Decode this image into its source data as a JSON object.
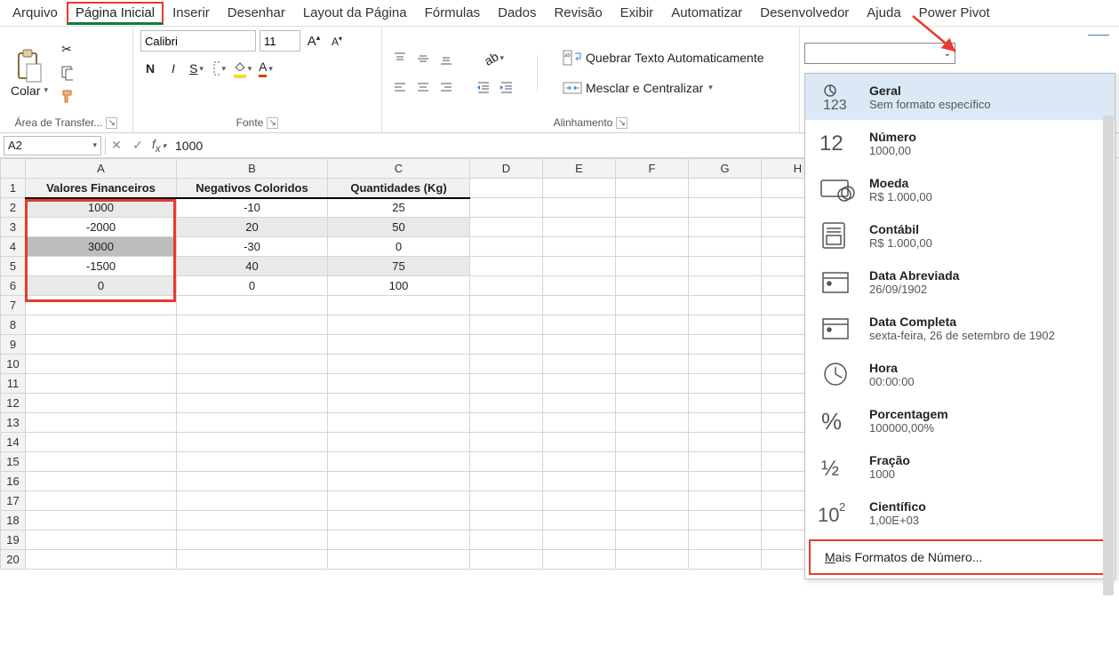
{
  "tabs": [
    "Arquivo",
    "Página Inicial",
    "Inserir",
    "Desenhar",
    "Layout da Página",
    "Fórmulas",
    "Dados",
    "Revisão",
    "Exibir",
    "Automatizar",
    "Desenvolvedor",
    "Ajuda",
    "Power Pivot"
  ],
  "active_tab_index": 1,
  "clipboard": {
    "paste": "Colar",
    "group": "Área de Transfer..."
  },
  "font": {
    "name": "Calibri",
    "size": "11",
    "group": "Fonte"
  },
  "alignment": {
    "wrap": "Quebrar Texto Automaticamente",
    "merge": "Mesclar e Centralizar",
    "group": "Alinhamento"
  },
  "name_box": "A2",
  "formula_value": "1000",
  "columns": [
    "A",
    "B",
    "C",
    "D",
    "E",
    "F",
    "G",
    "H"
  ],
  "headers": {
    "a": "Valores Financeiros",
    "b": "Negativos Coloridos",
    "c": "Quantidades (Kg)"
  },
  "rows": [
    {
      "n": "1"
    },
    {
      "n": "2",
      "a": "1000",
      "b": "-10",
      "c": "25"
    },
    {
      "n": "3",
      "a": "-2000",
      "b": "20",
      "c": "50"
    },
    {
      "n": "4",
      "a": "3000",
      "b": "-30",
      "c": "0"
    },
    {
      "n": "5",
      "a": "-1500",
      "b": "40",
      "c": "75"
    },
    {
      "n": "6",
      "a": "0",
      "b": "0",
      "c": "100"
    },
    {
      "n": "7"
    },
    {
      "n": "8"
    },
    {
      "n": "9"
    },
    {
      "n": "10"
    },
    {
      "n": "11"
    },
    {
      "n": "12"
    },
    {
      "n": "13"
    },
    {
      "n": "14"
    },
    {
      "n": "15"
    },
    {
      "n": "16"
    },
    {
      "n": "17"
    },
    {
      "n": "18"
    },
    {
      "n": "19"
    },
    {
      "n": "20"
    }
  ],
  "number_format": {
    "placeholder": "",
    "items": [
      {
        "title": "Geral",
        "sub": "Sem formato específico",
        "icon": "general"
      },
      {
        "title": "Número",
        "sub": "1000,00",
        "icon": "number"
      },
      {
        "title": "Moeda",
        "sub": "R$ 1.000,00",
        "icon": "currency"
      },
      {
        "title": "Contábil",
        "sub": "R$ 1.000,00",
        "icon": "accounting"
      },
      {
        "title": "Data Abreviada",
        "sub": "26/09/1902",
        "icon": "shortdate"
      },
      {
        "title": "Data Completa",
        "sub": "sexta-feira, 26 de setembro de 1902",
        "icon": "longdate"
      },
      {
        "title": "Hora",
        "sub": "00:00:00",
        "icon": "time"
      },
      {
        "title": "Porcentagem",
        "sub": "100000,00%",
        "icon": "percent"
      },
      {
        "title": "Fração",
        "sub": "1000",
        "icon": "fraction"
      },
      {
        "title": "Científico",
        "sub": "1,00E+03",
        "icon": "scientific"
      }
    ],
    "more_prefix": "M",
    "more_rest": "ais Formatos de Número..."
  }
}
